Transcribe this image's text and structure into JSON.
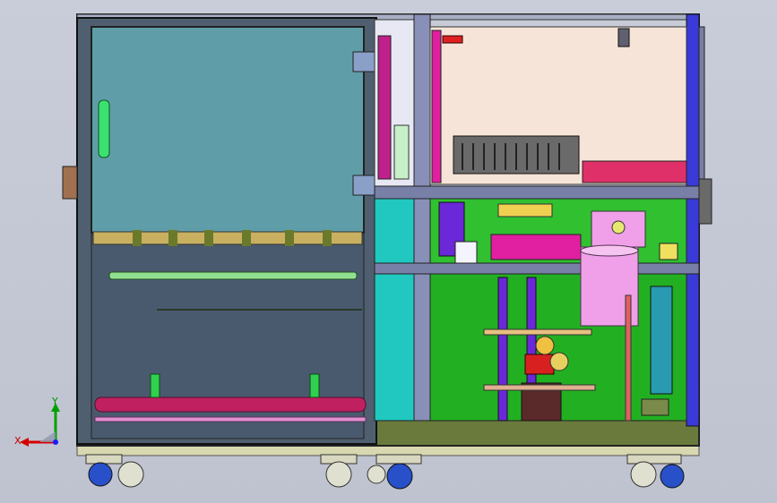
{
  "viewport": {
    "background": "#c8ccd8",
    "description_free": true
  },
  "triad": {
    "x_label": "X",
    "y_label": "Y",
    "x_color": "#d40000",
    "y_color": "#00a000",
    "z_color": "#1a1aff"
  },
  "colors": {
    "frame_dark": "#33365a",
    "cabinet_teal": "#5f9ea8",
    "cabinet_slate": "#4f5f70",
    "panel_salmon": "#f6e4d8",
    "green_panel": "#20b020",
    "magenta": "#e020a0",
    "purple": "#6a28d8",
    "pink_cylinder": "#f0a0e8",
    "olive_base": "#6a7a3c",
    "wheel_blue": "#2850c8"
  }
}
